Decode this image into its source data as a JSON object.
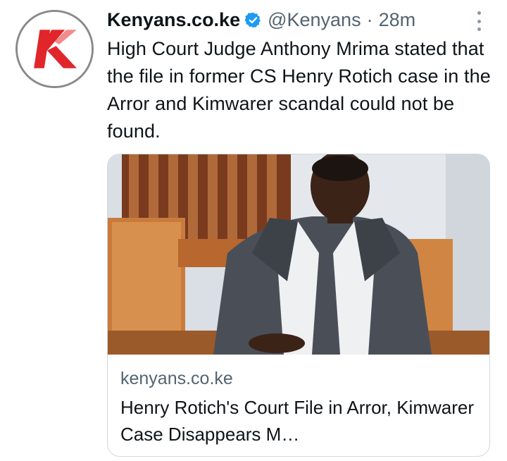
{
  "tweet": {
    "author_name": "Kenyans.co.ke",
    "handle": "@Kenyans",
    "separator": "·",
    "time": "28m",
    "text": "High Court Judge Anthony Mrima stated that the file in former CS Henry Rotich case in the Arror and Kimwarer scandal could not be found.",
    "verified": true
  },
  "card": {
    "domain": "kenyans.co.ke",
    "title": "Henry Rotich's Court File in Arror, Kimwarer Case Disappears M…"
  },
  "icons": {
    "avatar": "kenyans-k-logo-icon",
    "verified": "verified-badge-icon",
    "more": "more-options-icon"
  },
  "colors": {
    "brand_red": "#e0262b",
    "verified_blue": "#1d9bf0",
    "secondary_text": "#536471"
  }
}
